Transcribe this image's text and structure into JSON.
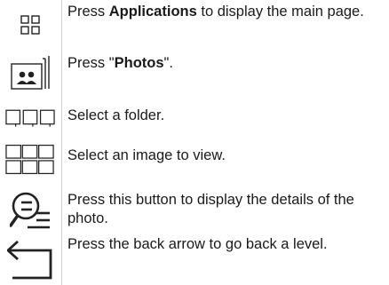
{
  "steps": [
    {
      "icon": "applications-grid-icon",
      "pre": "Press ",
      "bold": "Applications",
      "post": " to display the main page."
    },
    {
      "icon": "photos-icon",
      "pre": "Press \"",
      "bold": "Photos",
      "post": "\"."
    },
    {
      "icon": "folders-icon",
      "pre": "",
      "bold": "",
      "post": "Select a folder."
    },
    {
      "icon": "image-grid-icon",
      "pre": "",
      "bold": "",
      "post": "Select an image to view."
    },
    {
      "icon": "photo-details-icon",
      "pre": "",
      "bold": "",
      "post": "Press this button to display the details of the photo."
    },
    {
      "icon": "back-arrow-icon",
      "pre": "",
      "bold": "",
      "post": "Press the back arrow to go back a level."
    }
  ]
}
